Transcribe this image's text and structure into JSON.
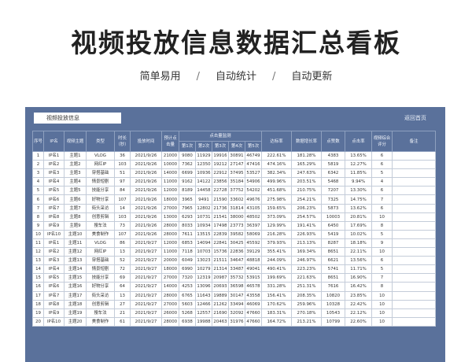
{
  "headline": "视频投放信息数据汇总看板",
  "tagline": {
    "a": "简单易用",
    "sep": "/",
    "b": "自动统计",
    "c": "自动更新"
  },
  "sheet": {
    "title": "视频投放信息",
    "home_button": "返回首页",
    "headers": {
      "seq": "序号",
      "ip": "IP名",
      "topic": "视频主题",
      "type": "类型",
      "duration": "时长（秒）",
      "date": "投放时间",
      "clicks": "预计点击量",
      "group": "点击量监测",
      "sub": [
        "第1次",
        "第2次",
        "第3次",
        "第4次",
        "第5次"
      ],
      "rate": "达标率",
      "ctr": "数据增长率",
      "likes": "点赞数",
      "like_rate": "点击率",
      "score": "视频综合评分",
      "note": "备注"
    },
    "rows": [
      [
        "1",
        "IP名1",
        "主题1",
        "VLOG",
        "36",
        "2021/9/26",
        "21000",
        "9080",
        "11929",
        "19916",
        "30891",
        "46749",
        "222.61%",
        "181.28%",
        "4383",
        "13.65%",
        "6",
        ""
      ],
      [
        "2",
        "IP名2",
        "主题2",
        "网红IP",
        "103",
        "2021/9/26",
        "10000",
        "7362",
        "12350",
        "19212",
        "27147",
        "47416",
        "474.16%",
        "165.29%",
        "5819",
        "12.27%",
        "6",
        ""
      ],
      [
        "3",
        "IP名3",
        "主题3",
        "穿搭基础",
        "51",
        "2021/9/26",
        "14000",
        "6699",
        "10936",
        "22912",
        "37495",
        "53527",
        "382.34%",
        "247.63%",
        "6342",
        "11.85%",
        "5",
        ""
      ],
      [
        "4",
        "IP名4",
        "主题4",
        "情景短剧",
        "97",
        "2021/9/26",
        "11000",
        "9162",
        "14122",
        "23856",
        "35184",
        "54906",
        "499.96%",
        "203.51%",
        "5468",
        "9.94%",
        "4",
        ""
      ],
      [
        "5",
        "IP名5",
        "主题5",
        "技能分享",
        "84",
        "2021/9/26",
        "12000",
        "8189",
        "14458",
        "22728",
        "37752",
        "54202",
        "451.68%",
        "210.75%",
        "7207",
        "13.30%",
        "6",
        ""
      ],
      [
        "6",
        "IP名6",
        "主题6",
        "好物分享",
        "107",
        "2021/9/26",
        "18000",
        "3965",
        "9491",
        "21590",
        "33602",
        "49676",
        "275.98%",
        "254.21%",
        "7325",
        "14.75%",
        "7",
        ""
      ],
      [
        "7",
        "IP名7",
        "主题7",
        "街头采访",
        "14",
        "2021/9/26",
        "27000",
        "7965",
        "12802",
        "21736",
        "31814",
        "43105",
        "159.65%",
        "206.23%",
        "5873",
        "13.62%",
        "6",
        ""
      ],
      [
        "8",
        "IP名8",
        "主题8",
        "创意剪辑",
        "103",
        "2021/9/26",
        "13000",
        "6293",
        "10731",
        "21541",
        "38000",
        "48502",
        "373.09%",
        "254.57%",
        "10003",
        "20.81%",
        "10",
        ""
      ],
      [
        "9",
        "IP名9",
        "主题9",
        "搜车法",
        "73",
        "2021/9/26",
        "28000",
        "8033",
        "10934",
        "17498",
        "23773",
        "36397",
        "129.99%",
        "191.41%",
        "6450",
        "17.69%",
        "8",
        ""
      ],
      [
        "10",
        "IP名10",
        "主题10",
        "美食制作",
        "107",
        "2021/9/26",
        "28000",
        "7611",
        "13515",
        "22839",
        "39582",
        "58069",
        "216.28%",
        "226.93%",
        "5419",
        "10.02%",
        "5",
        ""
      ],
      [
        "11",
        "IP名1",
        "主题11",
        "VLOG",
        "86",
        "2021/9/27",
        "12000",
        "6853",
        "14094",
        "22841",
        "30425",
        "45592",
        "379.93%",
        "213.13%",
        "8287",
        "18.18%",
        "9",
        ""
      ],
      [
        "12",
        "IP名2",
        "主题12",
        "网红IP",
        "13",
        "2021/9/27",
        "11000",
        "7118",
        "10703",
        "15736",
        "22836",
        "39129",
        "355.41%",
        "169.34%",
        "8651",
        "22.11%",
        "10",
        ""
      ],
      [
        "13",
        "IP名3",
        "主题13",
        "穿搭基础",
        "52",
        "2021/9/27",
        "20000",
        "6049",
        "13023",
        "21511",
        "34647",
        "48818",
        "244.09%",
        "246.97%",
        "6621",
        "13.56%",
        "6",
        ""
      ],
      [
        "14",
        "IP名4",
        "主题14",
        "情景短剧",
        "72",
        "2021/9/27",
        "18000",
        "6990",
        "10279",
        "21314",
        "33487",
        "49041",
        "490.41%",
        "223.23%",
        "5741",
        "11.71%",
        "5",
        ""
      ],
      [
        "15",
        "IP名5",
        "主题15",
        "技能分享",
        "69",
        "2021/9/27",
        "27000",
        "7320",
        "12319",
        "20987",
        "35732",
        "53915",
        "199.69%",
        "221.63%",
        "8651",
        "16.90%",
        "7",
        ""
      ],
      [
        "16",
        "IP名6",
        "主题16",
        "好物分享",
        "64",
        "2021/9/27",
        "14000",
        "4253",
        "13096",
        "20693",
        "36598",
        "46578",
        "331.28%",
        "251.31%",
        "7616",
        "16.42%",
        "8",
        ""
      ],
      [
        "17",
        "IP名7",
        "主题17",
        "街头采访",
        "13",
        "2021/9/27",
        "28000",
        "6765",
        "11643",
        "19889",
        "30147",
        "43558",
        "156.41%",
        "208.35%",
        "10820",
        "23.85%",
        "10",
        ""
      ],
      [
        "18",
        "IP名8",
        "主题18",
        "创意剪辑",
        "27",
        "2021/9/27",
        "27000",
        "5603",
        "12466",
        "21262",
        "33494",
        "46069",
        "170.62%",
        "259.96%",
        "10328",
        "22.42%",
        "10",
        ""
      ],
      [
        "19",
        "IP名9",
        "主题19",
        "搜车法",
        "21",
        "2021/9/27",
        "26000",
        "5268",
        "12557",
        "21690",
        "32092",
        "47660",
        "183.31%",
        "270.18%",
        "10543",
        "22.12%",
        "10",
        ""
      ],
      [
        "20",
        "IP名10",
        "主题20",
        "美食制作",
        "61",
        "2021/9/27",
        "28000",
        "6938",
        "19988",
        "20463",
        "31976",
        "47660",
        "164.72%",
        "213.21%",
        "10799",
        "22.60%",
        "10",
        ""
      ]
    ]
  }
}
